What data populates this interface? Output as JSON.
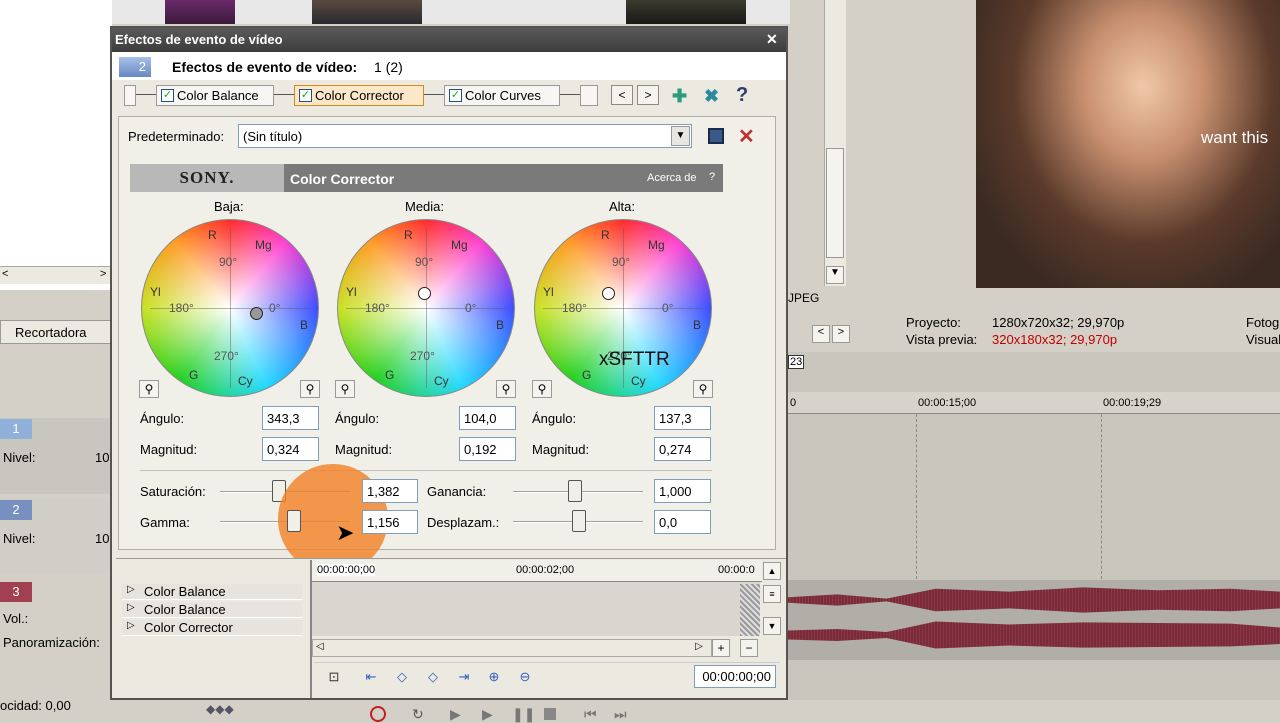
{
  "dialog": {
    "title": "Efectos de evento de vídeo",
    "header_label": "Efectos de evento de vídeo:",
    "header_value": "1 (2)",
    "track_badge": "2",
    "close_glyph": "✕"
  },
  "chain": {
    "items": [
      {
        "label": "Color Balance",
        "checked": true,
        "active": false
      },
      {
        "label": "Color Corrector",
        "checked": true,
        "active": true
      },
      {
        "label": "Color Curves",
        "checked": true,
        "active": false
      }
    ],
    "prev_glyph": "<",
    "next_glyph": ">",
    "help_glyph": "?"
  },
  "preset": {
    "label": "Predeterminado:",
    "value": "(Sin título)"
  },
  "plugin": {
    "vendor": "SONY.",
    "name": "Color Corrector",
    "about": "Acerca de",
    "about_q": "?"
  },
  "wheels": [
    {
      "title": "Baja:",
      "angle_label": "Ángulo:",
      "angle": "343,3",
      "mag_label": "Magnitud:",
      "mag": "0,324",
      "overlay": ""
    },
    {
      "title": "Media:",
      "angle_label": "Ángulo:",
      "angle": "104,0",
      "mag_label": "Magnitud:",
      "mag": "0,192",
      "overlay": ""
    },
    {
      "title": "Alta:",
      "angle_label": "Ángulo:",
      "angle": "137,3",
      "mag_label": "Magnitud:",
      "mag": "0,274",
      "overlay": "xSFTTR"
    }
  ],
  "wheel_labels": {
    "r": "R",
    "mg": "Mg",
    "b": "B",
    "cy": "Cy",
    "g": "G",
    "yl": "Yl",
    "d90": "90°",
    "d180": "180°",
    "d0": "0°",
    "d270": "270°"
  },
  "sliders": {
    "saturacion": {
      "label": "Saturación:",
      "value": "1,382"
    },
    "gamma": {
      "label": "Gamma:",
      "value": "1,156"
    },
    "ganancia": {
      "label": "Ganancia:",
      "value": "1,000"
    },
    "desplazam": {
      "label": "Desplazam.:",
      "value": "0,0"
    }
  },
  "timeline": {
    "ticks": [
      "00:00:00;00",
      "00:00:02;00",
      "00:00:0"
    ],
    "tracks": [
      "Color Balance",
      "Color Balance",
      "Color Corrector"
    ],
    "timecode": "00:00:00;00"
  },
  "background": {
    "recortadora": "Recortadora",
    "track1": "1",
    "track2": "2",
    "track3": "3",
    "nivel": "Nivel:",
    "nivel_val": "10",
    "vol": "Vol.:",
    "panorama": "Panoramización:",
    "velocidad": "ocidad: 0,00",
    "jpeg": "JPEG",
    "proyecto_label": "Proyecto:",
    "proyecto_val": "1280x720x32; 29,970p",
    "vista_label": "Vista previa:",
    "vista_val": "320x180x32; 29,970p",
    "foto": "Fotog",
    "visual": "Visual",
    "tc1": "00:00:15;00",
    "tc2": "00:00:19;29",
    "marker": "23",
    "preview_text": "want this",
    "tc0": "0"
  }
}
